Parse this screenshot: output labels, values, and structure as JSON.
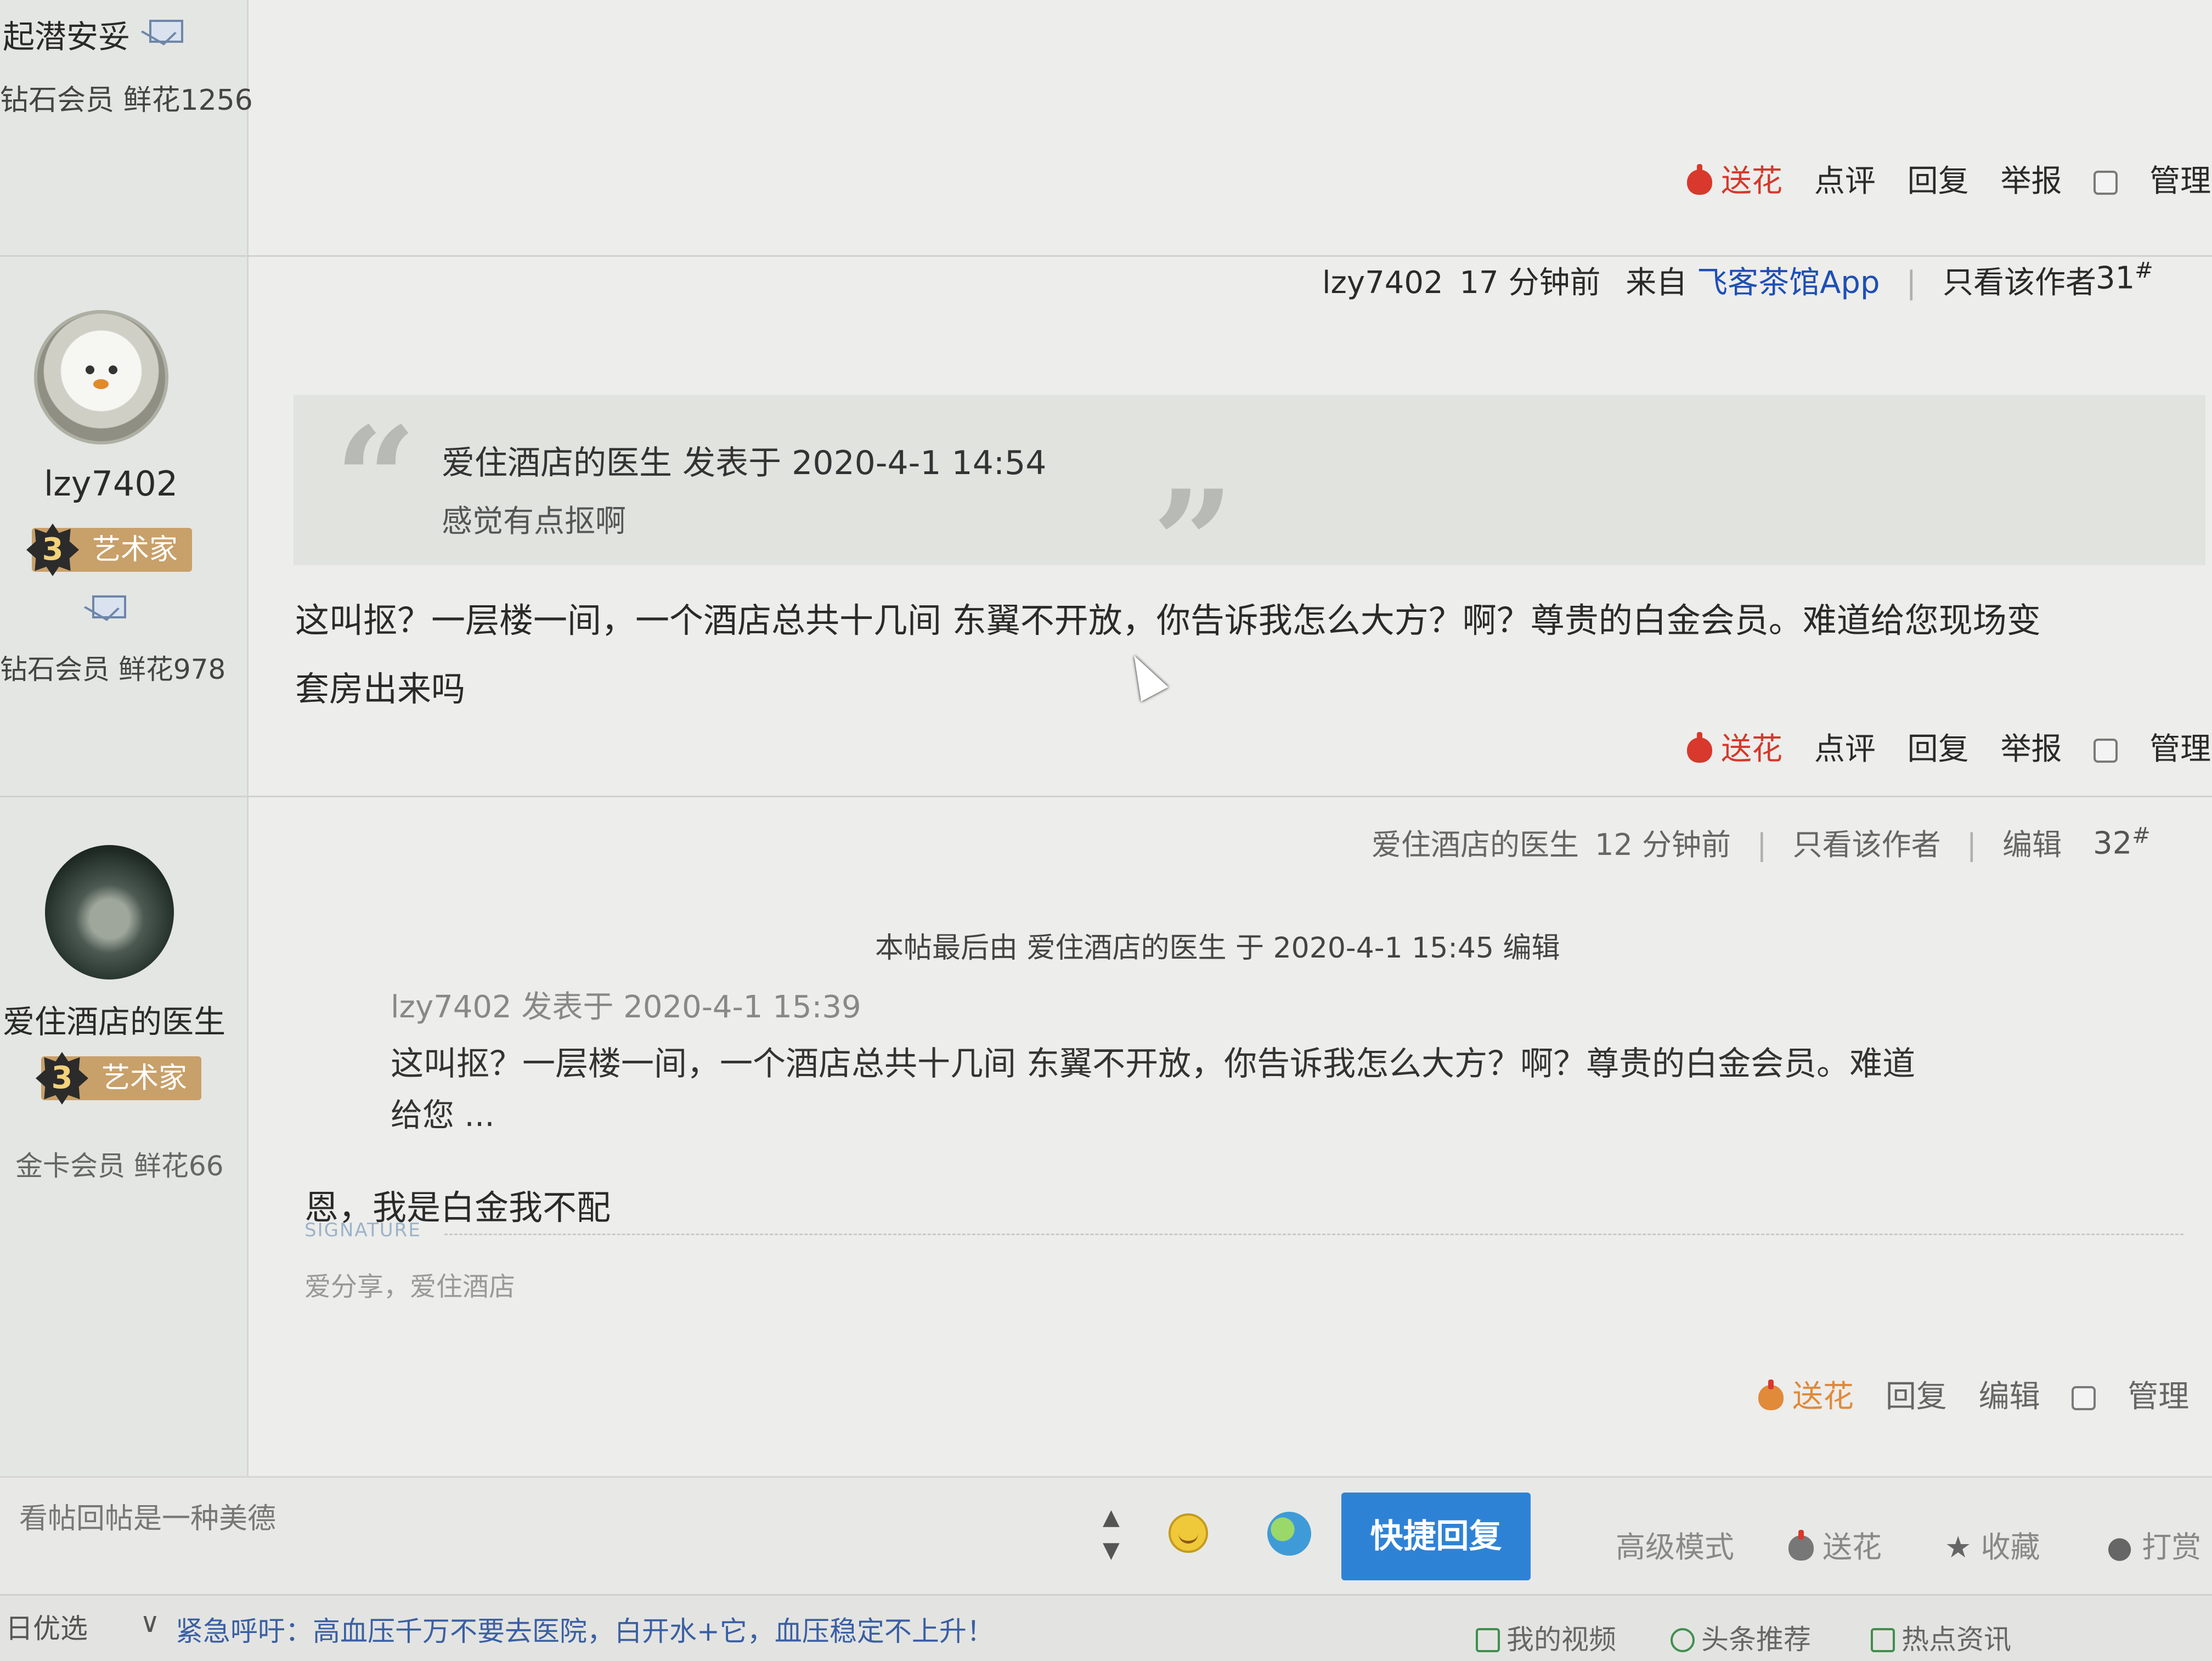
{
  "prev_user": {
    "name": "起潜安妥",
    "stats": "钻石会员 鲜花1256"
  },
  "actions_top": {
    "flower": "送花",
    "comment": "点评",
    "reply": "回复",
    "report": "举报",
    "manage": "管理"
  },
  "post31": {
    "meta_user": "lzy7402",
    "meta_time": "17 分钟前",
    "meta_from": "来自",
    "meta_app": "飞客茶馆App",
    "only_author": "只看该作者",
    "floor": "31",
    "floor_mark": "#",
    "author": {
      "name": "lzy7402",
      "level": "3",
      "title": "艺术家",
      "stats": "钻石会员 鲜花978"
    },
    "quote_header": "爱住酒店的医生 发表于 2020-4-1 14:54",
    "quote_text": "感觉有点抠啊",
    "body_line1": "这叫抠？一层楼一间，一个酒店总共十几间 东翼不开放，你告诉我怎么大方？啊？尊贵的白金会员。难道给您现场变",
    "body_line2": "套房出来吗",
    "actions": {
      "flower": "送花",
      "comment": "点评",
      "reply": "回复",
      "report": "举报",
      "manage": "管理"
    }
  },
  "post32": {
    "meta_user": "爱住酒店的医生",
    "meta_time": "12 分钟前",
    "only_author": "只看该作者",
    "edit": "编辑",
    "floor": "32",
    "floor_mark": "#",
    "author": {
      "name": "爱住酒店的医生",
      "level": "3",
      "title": "艺术家",
      "stats": "金卡会员 鲜花66"
    },
    "edit_notice": "本帖最后由 爱住酒店的医生 于 2020-4-1 15:45 编辑",
    "quote_header": "lzy7402 发表于 2020-4-1 15:39",
    "quote_line1": "这叫抠？一层楼一间，一个酒店总共十几间 东翼不开放，你告诉我怎么大方？啊？尊贵的白金会员。难道",
    "quote_line2": "给您 ...",
    "body": "恩，我是白金我不配",
    "signature_label": "SIGNATURE",
    "signature_text": "爱分享，爱住酒店",
    "actions": {
      "flower": "送花",
      "reply": "回复",
      "edit": "编辑",
      "manage": "管理"
    }
  },
  "bottom": {
    "slogan": "看帖回帖是一种美德",
    "quick_reply": "快捷回复",
    "advanced": "高级模式",
    "flower": "送花",
    "favorite": "收藏",
    "tip": "打赏"
  },
  "ticker": {
    "left": "日优选",
    "headline": "紧急呼吁：高血压千万不要去医院，白开水+它，血压稳定不上升！",
    "video": "我的视频",
    "news": "头条推荐",
    "hot": "热点资讯"
  }
}
